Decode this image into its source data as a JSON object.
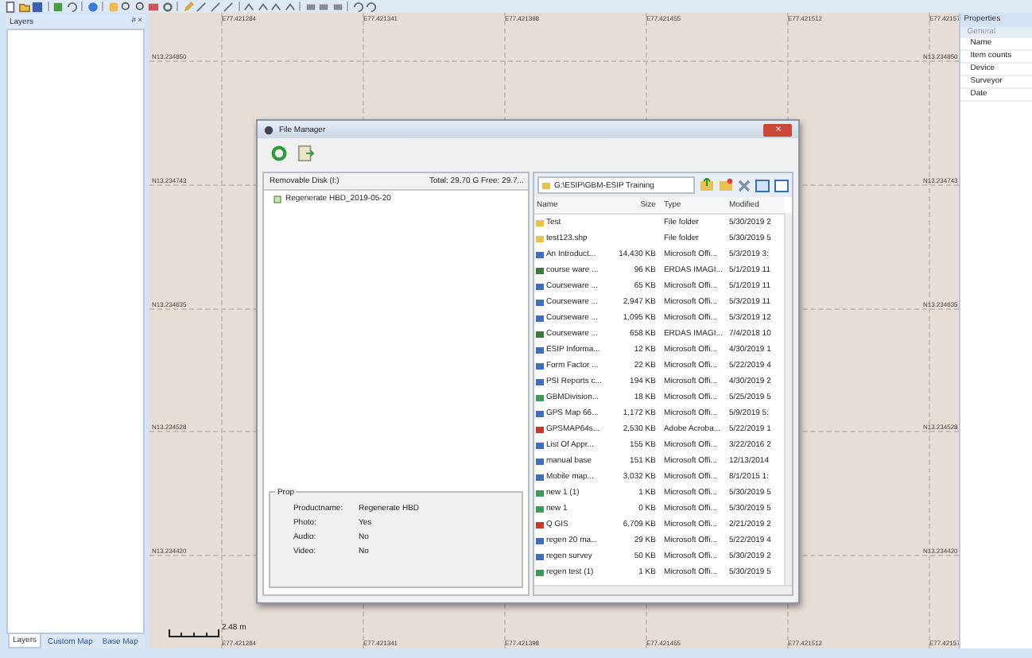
{
  "layers_panel": {
    "title": "Layers",
    "pin": "#",
    "close": "×",
    "tabs": [
      {
        "label": "Layers",
        "selected": true
      },
      {
        "label": "Custom Map",
        "selected": false
      },
      {
        "label": "Base Map",
        "selected": false
      }
    ]
  },
  "map": {
    "top_labels": [
      "E77.421284",
      "E77.421341",
      "E77.421398",
      "E77.421455",
      "E77.421512",
      "E77.42157"
    ],
    "bottom_labels": [
      "E77.421284",
      "E77.421341",
      "E77.421398",
      "E77.421455",
      "E77.421512",
      "E77.42157"
    ],
    "left_labels": [
      "N13.234850",
      "N13.234743",
      "N13.234635",
      "N13.234528",
      "N13.234420"
    ],
    "right_labels": [
      "N13.234850",
      "N13.234743",
      "N13.234635",
      "N13.234528",
      "N13.234420"
    ],
    "scale": "2.48 m"
  },
  "properties_panel": {
    "title": "Properties",
    "group": "General",
    "rows": [
      "Name",
      "Item counts",
      "Device",
      "Surveyor",
      "Date"
    ]
  },
  "file_manager": {
    "title": "File Manager",
    "close": "×",
    "drive": "Removable Disk (I:)",
    "space": "Total: 29.70 G Free: 29.7...",
    "tree": [
      {
        "label": "Regenerate HBD_2019-05-20"
      }
    ],
    "props_title": "Prop",
    "props": [
      {
        "label": "Productname:",
        "value": "Regenerate HBD"
      },
      {
        "label": "Photo:",
        "value": "Yes"
      },
      {
        "label": "Audio:",
        "value": "No"
      },
      {
        "label": "Video:",
        "value": "No"
      }
    ],
    "path": "G:\\ESIP\\GBM-ESIP Training",
    "columns": [
      "Name",
      "Size",
      "Type",
      "Modified"
    ],
    "files": [
      {
        "kind": "folder",
        "name": "Test",
        "type": "File folder",
        "modified": "5/30/2019 2"
      },
      {
        "kind": "folder",
        "name": "test123.shp",
        "type": "File folder",
        "modified": "5/30/2019 5"
      },
      {
        "kind": "doc",
        "name": "An Introduct...",
        "size": "14,430 KB",
        "type": "Microsoft Offi...",
        "modified": "5/3/2019 3:"
      },
      {
        "kind": "img",
        "name": "course ware ...",
        "size": "96 KB",
        "type": "ERDAS IMAGI...",
        "modified": "5/1/2019 11"
      },
      {
        "kind": "doc",
        "name": "Courseware ...",
        "size": "65 KB",
        "type": "Microsoft Offi...",
        "modified": "5/1/2019 11"
      },
      {
        "kind": "doc",
        "name": "Courseware ...",
        "size": "2,947 KB",
        "type": "Microsoft Offi...",
        "modified": "5/3/2019 11"
      },
      {
        "kind": "doc",
        "name": "Courseware ...",
        "size": "1,095 KB",
        "type": "Microsoft Offi...",
        "modified": "5/3/2019 12"
      },
      {
        "kind": "img",
        "name": "Courseware ...",
        "size": "658 KB",
        "type": "ERDAS IMAGI...",
        "modified": "7/4/2018 10"
      },
      {
        "kind": "doc",
        "name": "ESIP Informa...",
        "size": "12 KB",
        "type": "Microsoft Offi...",
        "modified": "4/30/2019 1"
      },
      {
        "kind": "doc",
        "name": "Form Factor ...",
        "size": "22 KB",
        "type": "Microsoft Offi...",
        "modified": "5/22/2019 4"
      },
      {
        "kind": "doc",
        "name": "PSI Reports c...",
        "size": "194 KB",
        "type": "Microsoft Offi...",
        "modified": "4/30/2019 2"
      },
      {
        "kind": "sheet",
        "name": "GBMDivision...",
        "size": "18 KB",
        "type": "Microsoft Offi...",
        "modified": "5/25/2019 5"
      },
      {
        "kind": "doc",
        "name": "GPS Map 66...",
        "size": "1,172 KB",
        "type": "Microsoft Offi...",
        "modified": "5/9/2019 5:"
      },
      {
        "kind": "pdf",
        "name": "GPSMAP64s...",
        "size": "2,530 KB",
        "type": "Adobe Acroba...",
        "modified": "5/22/2019 1"
      },
      {
        "kind": "doc",
        "name": "List Of Appr...",
        "size": "155 KB",
        "type": "Microsoft Offi...",
        "modified": "3/22/2016 2"
      },
      {
        "kind": "doc",
        "name": "manual base",
        "size": "151 KB",
        "type": "Microsoft Offi...",
        "modified": "12/13/2014"
      },
      {
        "kind": "doc",
        "name": "Mobile map...",
        "size": "3,032 KB",
        "type": "Microsoft Offi...",
        "modified": "8/1/2015 1:"
      },
      {
        "kind": "sheet",
        "name": "new 1 (1)",
        "size": "1 KB",
        "type": "Microsoft Offi...",
        "modified": "5/30/2019 5"
      },
      {
        "kind": "sheet",
        "name": "new 1",
        "size": "0 KB",
        "type": "Microsoft Offi...",
        "modified": "5/30/2019 5"
      },
      {
        "kind": "pdf",
        "name": "Q GIS",
        "size": "6,709 KB",
        "type": "Microsoft Offi...",
        "modified": "2/21/2019 2"
      },
      {
        "kind": "doc",
        "name": "regen 20 ma...",
        "size": "29 KB",
        "type": "Microsoft Offi...",
        "modified": "5/22/2019 4"
      },
      {
        "kind": "doc",
        "name": "regen survey",
        "size": "50 KB",
        "type": "Microsoft Offi...",
        "modified": "5/30/2019 2"
      },
      {
        "kind": "sheet",
        "name": "regen test (1)",
        "size": "1 KB",
        "type": "Microsoft Offi...",
        "modified": "5/30/2019 5"
      }
    ]
  }
}
